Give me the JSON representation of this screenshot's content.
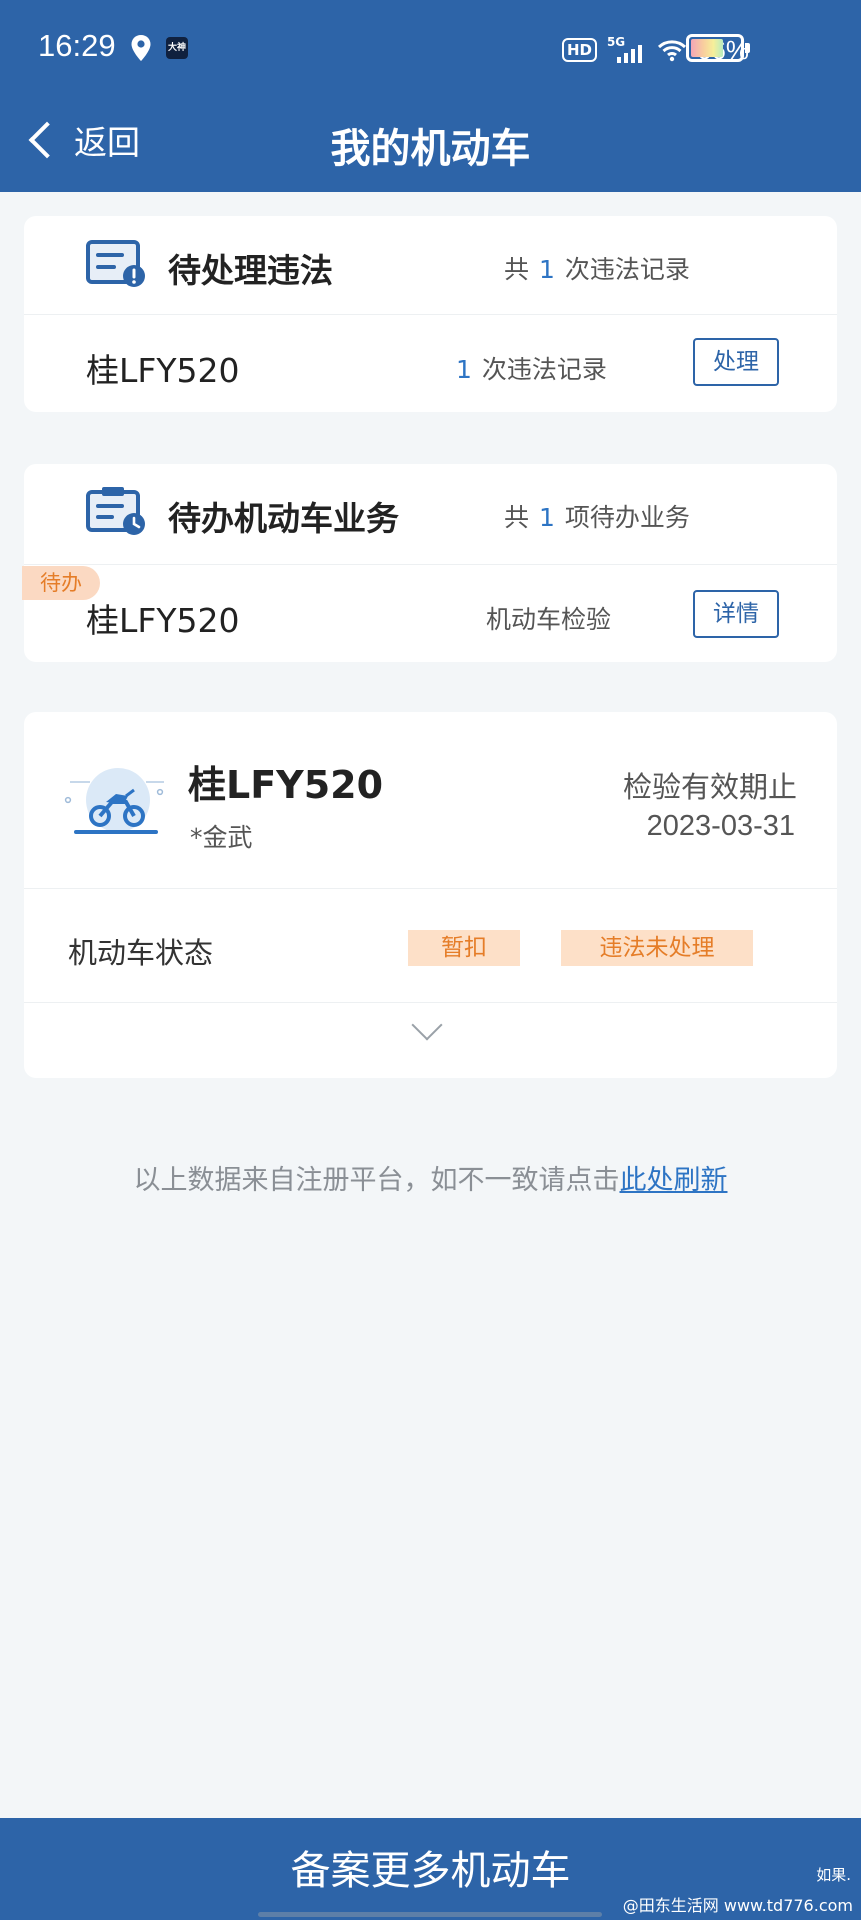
{
  "status_bar": {
    "time": "16:29",
    "network": "5G",
    "hd": "HD",
    "battery": "66%"
  },
  "nav": {
    "back_label": "返回",
    "title": "我的机动车"
  },
  "violations": {
    "title": "待处理违法",
    "count_prefix": "共",
    "count": "1",
    "count_suffix": "次违法记录",
    "item": {
      "plate": "桂LFY520",
      "count": "1",
      "count_suffix": "次违法记录",
      "action": "处理"
    }
  },
  "business": {
    "title": "待办机动车业务",
    "count_prefix": "共",
    "count": "1",
    "count_suffix": "项待办业务",
    "item": {
      "tag": "待办",
      "plate": "桂LFY520",
      "type": "机动车检验",
      "action": "详情"
    }
  },
  "vehicle": {
    "icon": "motorcycle-icon",
    "plate": "桂LFY520",
    "owner": "*金武",
    "expiry_label": "检验有效期止",
    "expiry_date": "2023-03-31",
    "status_label": "机动车状态",
    "status_badges": [
      "暂扣",
      "违法未处理"
    ]
  },
  "footer_note": {
    "text": "以上数据来自注册平台，如不一致请点击",
    "link": "此处刷新"
  },
  "bottom_button": {
    "label": "备案更多机动车"
  },
  "watermark": {
    "line1": "如果.",
    "line2": "@田东生活网 www.td776.com"
  },
  "colors": {
    "primary": "#2d64a8",
    "accent_blue": "#2d74c4",
    "badge_bg": "#fde0c8",
    "badge_text": "#e57d28"
  }
}
